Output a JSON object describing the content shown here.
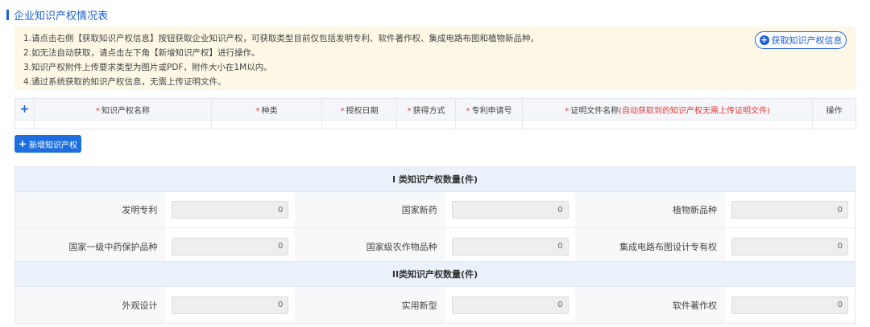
{
  "section": {
    "title": "企业知识产权情况表"
  },
  "notice": {
    "lines": [
      "1.请点击右侧【获取知识产权信息】按钮获取企业知识产权，可获取类型目前仅包括发明专利、软件著作权、集成电路布图和植物新品种。",
      "2.如无法自动获取，请点击左下角【新增知识产权】进行操作。",
      "3.知识产权附件上传要求类型为图片或PDF，附件大小在1M以内。",
      "4.通过系统获取的知识产权信息，无需上传证明文件。"
    ],
    "fetch_button": "获取知识产权信息"
  },
  "table": {
    "plus": "+",
    "required_mark": "*",
    "col_name": "知识产权名称",
    "col_type": "种类",
    "col_date": "授权日期",
    "col_method": "获得方式",
    "col_patent_no": "专利申请号",
    "col_proof": "证明文件名称",
    "col_proof_note": "(自动获取到的知识产权无需上传证明文件)",
    "col_ops": "操作"
  },
  "add_button": {
    "plus": "+",
    "label": "新增知识产权"
  },
  "class1": {
    "title": "I 类知识产权数量(件)",
    "rows": [
      [
        {
          "label": "发明专利",
          "value": "0"
        },
        {
          "label": "国家新药",
          "value": "0"
        },
        {
          "label": "植物新品种",
          "value": "0"
        }
      ],
      [
        {
          "label": "国家一级中药保护品种",
          "value": "0"
        },
        {
          "label": "国家级农作物品种",
          "value": "0"
        },
        {
          "label": "集成电路布图设计专有权",
          "value": "0"
        }
      ]
    ]
  },
  "class2": {
    "title": "II类知识产权数量(件)",
    "rows": [
      [
        {
          "label": "外观设计",
          "value": "0"
        },
        {
          "label": "实用新型",
          "value": "0"
        },
        {
          "label": "软件著作权",
          "value": "0"
        }
      ]
    ]
  },
  "colors": {
    "accent": "#1e5fd6",
    "required": "#e23b3b",
    "notice_bg": "#fdf8e6",
    "header_bg": "#eaf1fa"
  }
}
